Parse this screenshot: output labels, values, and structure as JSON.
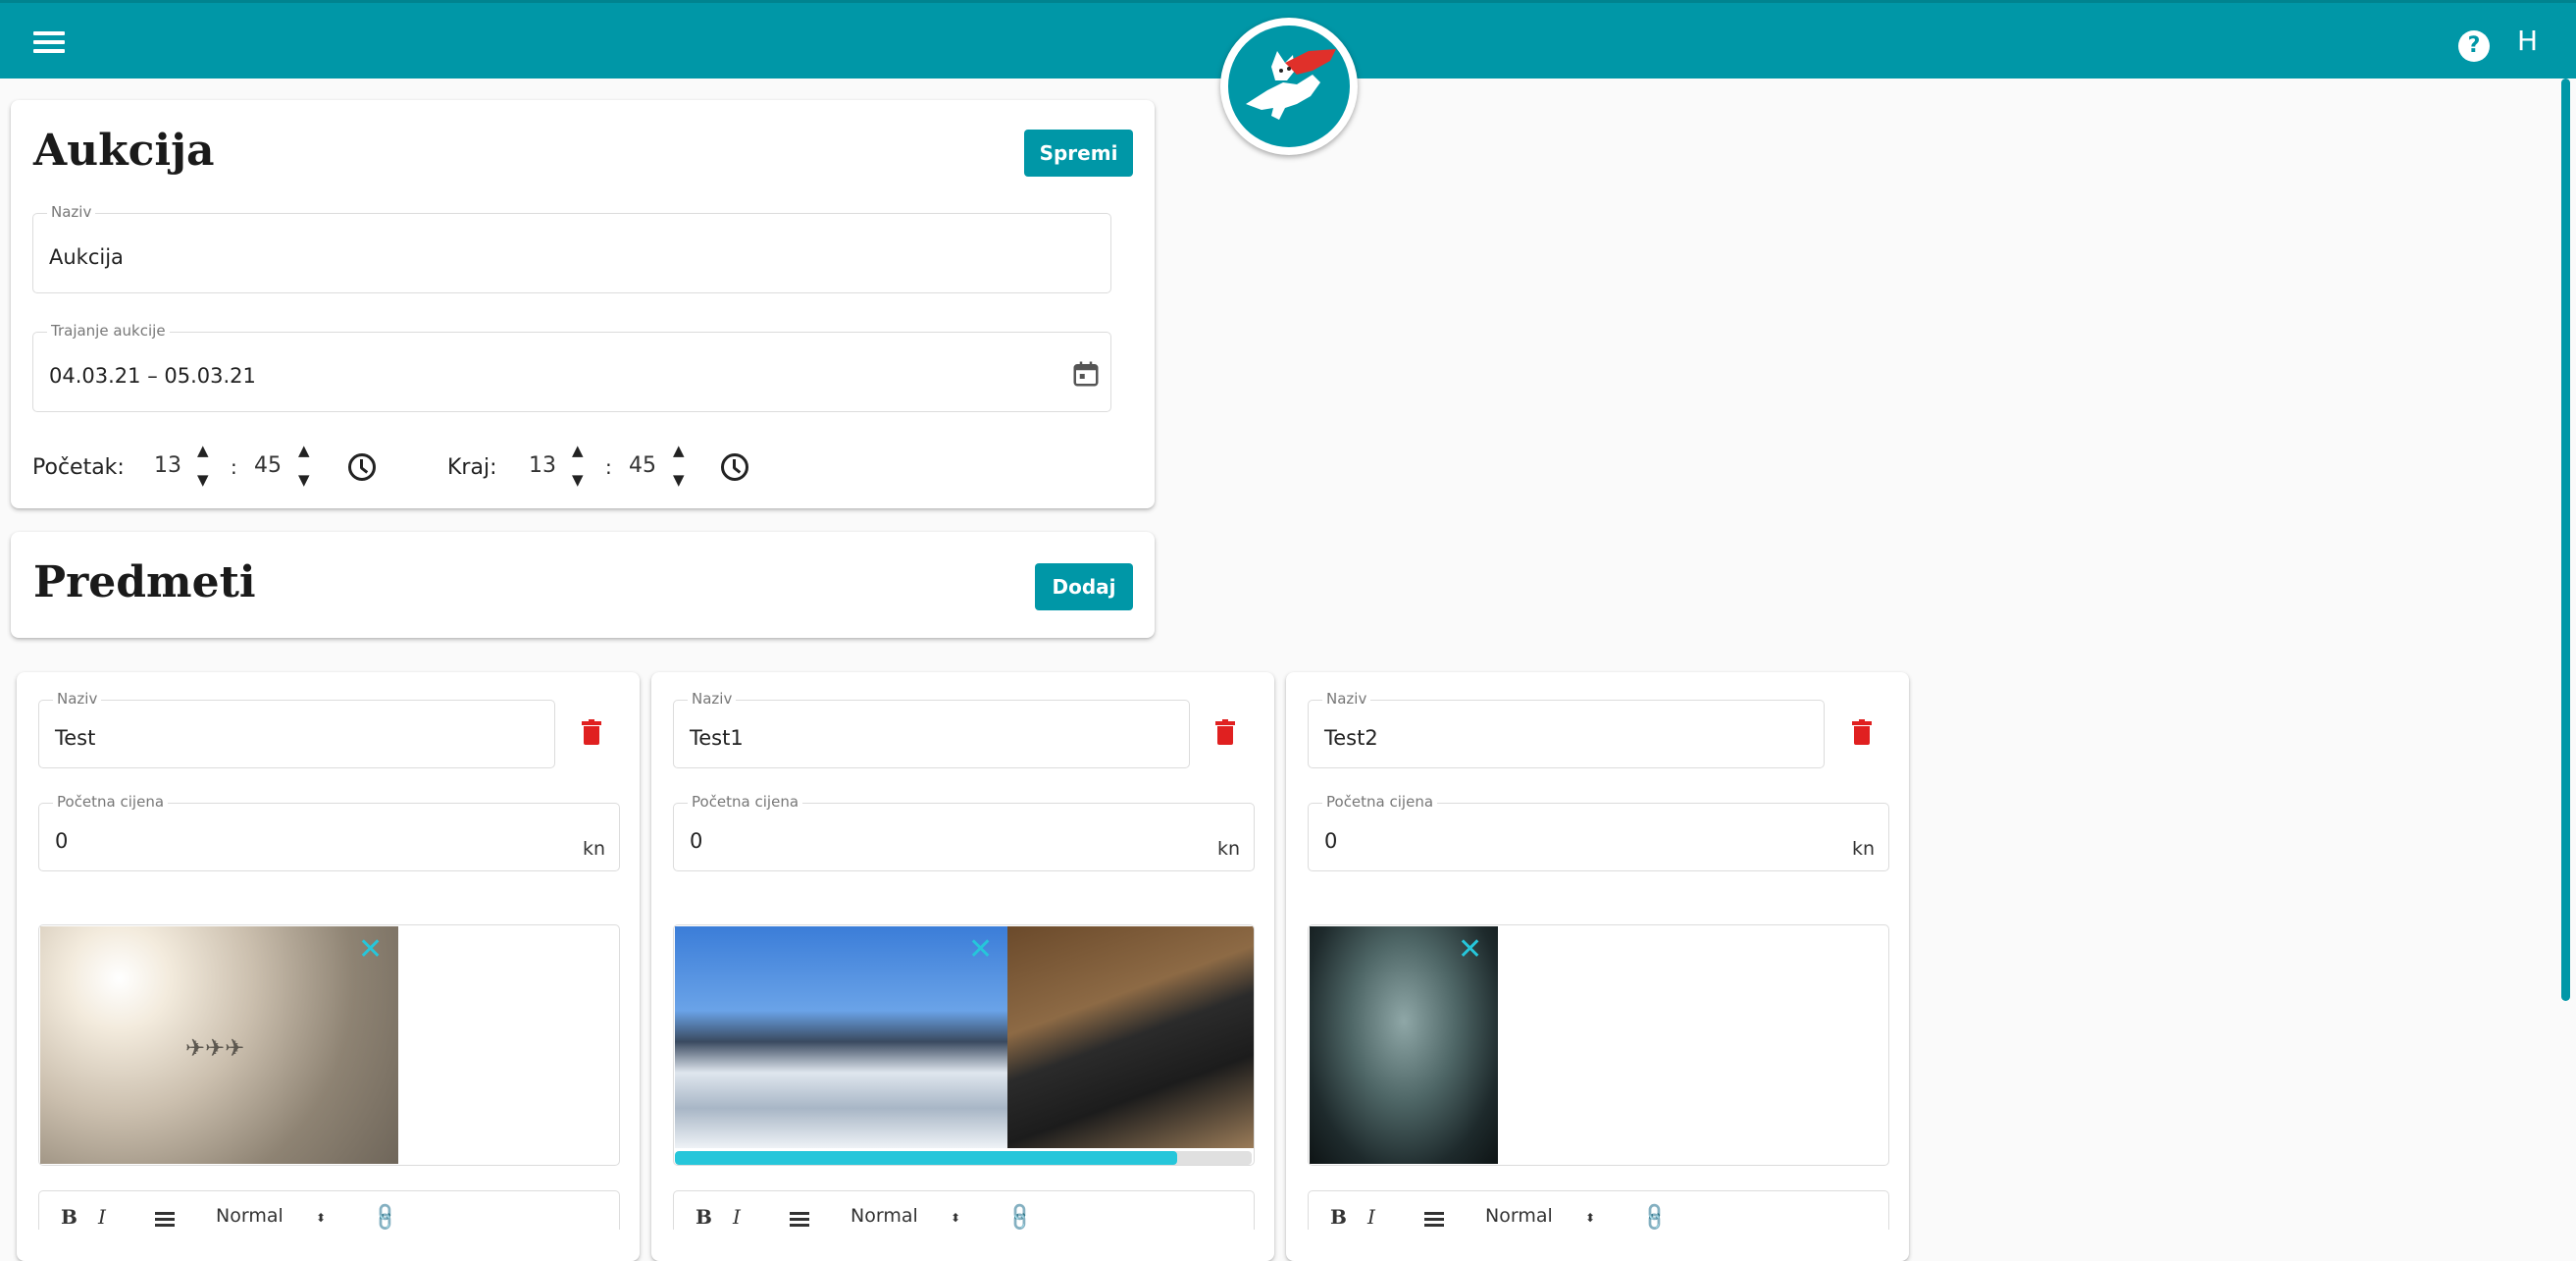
{
  "header": {
    "menu_icon": "hamburger-menu-icon",
    "help_symbol": "?",
    "user_initial": "H",
    "logo_icon": "flying-cat-mascot-logo",
    "color": "#0097a7"
  },
  "auction": {
    "title": "Aukcija",
    "save_label": "Spremi",
    "name_field": {
      "label": "Naziv",
      "value": "Aukcija"
    },
    "duration_field": {
      "label": "Trajanje aukcije",
      "value": "04.03.21 – 05.03.21"
    },
    "start": {
      "label": "Početak:",
      "hour": "13",
      "minute": "45"
    },
    "end": {
      "label": "Kraj:",
      "hour": "13",
      "minute": "45"
    },
    "up_arrow": "▲",
    "down_arrow": "▼",
    "colon": ":"
  },
  "items_section": {
    "title": "Predmeti",
    "add_label": "Dodaj"
  },
  "items": [
    {
      "name_label": "Naziv",
      "name": "Test",
      "price_label": "Početna cijena",
      "price": "0",
      "currency": "kn",
      "images": [
        "sky-airplanes-photo"
      ]
    },
    {
      "name_label": "Naziv",
      "name": "Test1",
      "price_label": "Početna cijena",
      "price": "0",
      "currency": "kn",
      "images": [
        "snowy-mountains-photo",
        "laptop-phone-photo"
      ],
      "upload_progress": 0.87
    },
    {
      "name_label": "Naziv",
      "name": "Test2",
      "price_label": "Početna cijena",
      "price": "0",
      "currency": "kn",
      "images": [
        "forks-photo"
      ]
    }
  ],
  "editor": {
    "bold": "B",
    "italic": "I",
    "format": "Normal",
    "caret": "⬍",
    "link": "🔗"
  },
  "remove_symbol": "✕",
  "colors": {
    "accent": "#0097a7",
    "delete": "#e02020",
    "remove": "#26c6da"
  }
}
